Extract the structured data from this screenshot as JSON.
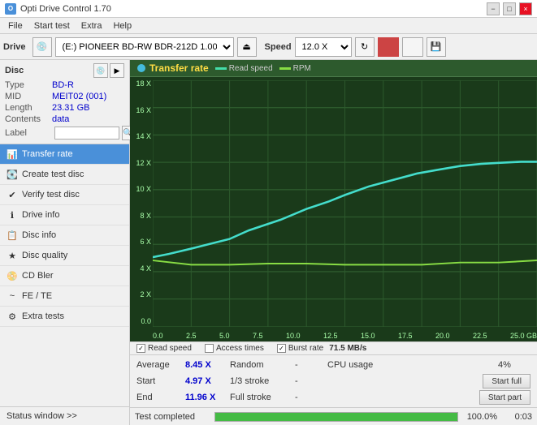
{
  "titleBar": {
    "title": "Opti Drive Control 1.70",
    "minimizeLabel": "−",
    "maximizeLabel": "□",
    "closeLabel": "×"
  },
  "menuBar": {
    "items": [
      "File",
      "Start test",
      "Extra",
      "Help"
    ]
  },
  "toolbar": {
    "driveLabel": "Drive",
    "driveValue": "(E:)  PIONEER BD-RW   BDR-212D 1.00",
    "ejectTitle": "⏏",
    "speedLabel": "Speed",
    "speedValue": "12.0 X"
  },
  "disc": {
    "title": "Disc",
    "typeKey": "Type",
    "typeVal": "BD-R",
    "midKey": "MID",
    "midVal": "MEIT02 (001)",
    "lengthKey": "Length",
    "lengthVal": "23.31 GB",
    "contentsKey": "Contents",
    "contentsVal": "data",
    "labelKey": "Label",
    "labelPlaceholder": ""
  },
  "nav": {
    "items": [
      {
        "id": "transfer-rate",
        "label": "Transfer rate",
        "active": true
      },
      {
        "id": "create-test-disc",
        "label": "Create test disc",
        "active": false
      },
      {
        "id": "verify-test-disc",
        "label": "Verify test disc",
        "active": false
      },
      {
        "id": "drive-info",
        "label": "Drive info",
        "active": false
      },
      {
        "id": "disc-info",
        "label": "Disc info",
        "active": false
      },
      {
        "id": "disc-quality",
        "label": "Disc quality",
        "active": false
      },
      {
        "id": "cd-bler",
        "label": "CD Bler",
        "active": false
      },
      {
        "id": "fe-te",
        "label": "FE / TE",
        "active": false
      },
      {
        "id": "extra-tests",
        "label": "Extra tests",
        "active": false
      }
    ],
    "statusWindow": "Status window >>"
  },
  "chart": {
    "title": "Transfer rate",
    "legend": {
      "readSpeedLabel": "Read speed",
      "rpmLabel": "RPM",
      "readSpeedColor": "#44ddaa",
      "rpmColor": "#88dd44"
    },
    "yAxisLabels": [
      "18 X",
      "16 X",
      "14 X",
      "12 X",
      "10 X",
      "8 X",
      "6 X",
      "4 X",
      "2 X",
      "0.0"
    ],
    "xAxisLabels": [
      "0.0",
      "2.5",
      "5.0",
      "7.5",
      "10.0",
      "12.5",
      "15.0",
      "17.5",
      "20.0",
      "22.5",
      "25.0 GB"
    ]
  },
  "checkboxes": {
    "readSpeedChecked": true,
    "readSpeedLabel": "Read speed",
    "accessTimesChecked": false,
    "accessTimesLabel": "Access times",
    "burstRateChecked": true,
    "burstRateLabel": "Burst rate",
    "burstRateVal": "71.5 MB/s"
  },
  "stats": {
    "averageKey": "Average",
    "averageVal": "8.45 X",
    "randomKey": "Random",
    "randomVal": "-",
    "cpuUsageKey": "CPU usage",
    "cpuUsageVal": "4%",
    "startKey": "Start",
    "startVal": "4.97 X",
    "strokeKey": "1/3 stroke",
    "strokeVal": "-",
    "startFullLabel": "Start full",
    "endKey": "End",
    "endVal": "11.96 X",
    "fullStrokeKey": "Full stroke",
    "fullStrokeVal": "-",
    "startPartLabel": "Start part"
  },
  "statusBar": {
    "statusText": "Test completed",
    "progressPercent": 100,
    "progressLabel": "100.0%",
    "timeLabel": "0:03"
  }
}
